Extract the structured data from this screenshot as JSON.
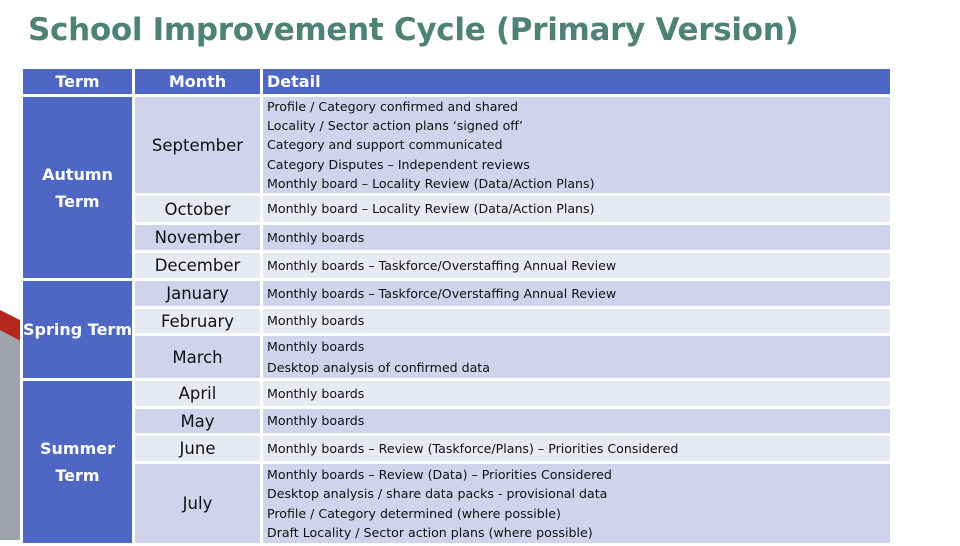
{
  "title": "School Improvement Cycle (Primary Version)",
  "table": {
    "headers": {
      "term": "Term",
      "month": "Month",
      "detail": "Detail"
    },
    "terms": [
      {
        "label": "Autumn Term",
        "lines": [
          "Autumn",
          "Term"
        ]
      },
      {
        "label": "Spring Term",
        "lines": [
          "Spring Term"
        ]
      },
      {
        "label": "Summer Term",
        "lines": [
          "Summer",
          "Term"
        ]
      }
    ],
    "rows": [
      {
        "month": "September",
        "detail": [
          "Profile / Category confirmed and shared",
          "Locality / Sector action plans ‘signed off’",
          "Category and support communicated",
          "Category Disputes – Independent reviews",
          "Monthly board – Locality Review (Data/Action Plans)"
        ]
      },
      {
        "month": "October",
        "detail": [
          "Monthly board – Locality Review (Data/Action Plans)"
        ]
      },
      {
        "month": "November",
        "detail": [
          "Monthly boards"
        ]
      },
      {
        "month": "December",
        "detail": [
          "Monthly boards – Taskforce/Overstaffing Annual Review"
        ]
      },
      {
        "month": "January",
        "detail": [
          "Monthly boards – Taskforce/Overstaffing Annual Review"
        ]
      },
      {
        "month": "February",
        "detail": [
          "Monthly boards"
        ]
      },
      {
        "month": "March",
        "detail": [
          "Monthly boards",
          "Desktop analysis of confirmed data"
        ]
      },
      {
        "month": "April",
        "detail": [
          "Monthly boards"
        ]
      },
      {
        "month": "May",
        "detail": [
          "Monthly boards"
        ]
      },
      {
        "month": "June",
        "detail": [
          "Monthly boards – Review (Taskforce/Plans) – Priorities Considered"
        ]
      },
      {
        "month": "July",
        "detail": [
          "Monthly boards – Review (Data) – Priorities Considered",
          "Desktop analysis / share data packs - provisional data",
          "Profile / Category determined (where possible)",
          "Draft Locality / Sector action plans (where possible)"
        ]
      }
    ]
  },
  "colors": {
    "title": "#4e8275",
    "header_bg": "#4e66c4",
    "row_dark": "#d0d3eb",
    "row_light": "#e8eaf3",
    "accent_red": "#b5271f",
    "accent_gray": "#9ea3a9"
  }
}
